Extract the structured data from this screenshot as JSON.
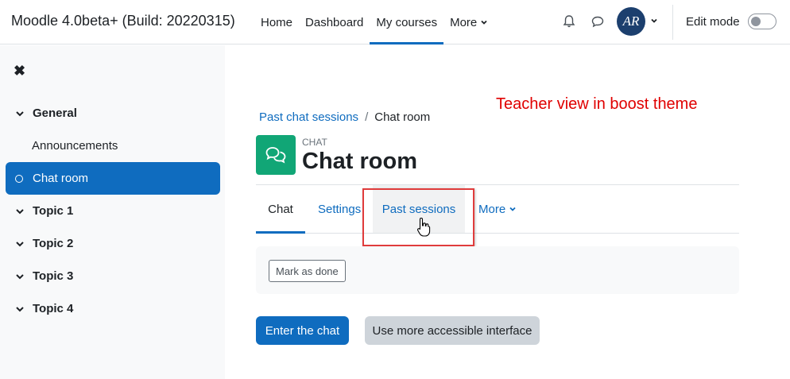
{
  "site": {
    "name": "Moodle 4.0beta+ (Build: 20220315)"
  },
  "primary_nav": [
    {
      "label": "Home"
    },
    {
      "label": "Dashboard"
    },
    {
      "label": "My courses",
      "active": true
    },
    {
      "label": "More",
      "has_caret": true
    }
  ],
  "user": {
    "avatar_initials": "AR"
  },
  "edit_mode": {
    "label": "Edit mode",
    "on": false
  },
  "drawer": {
    "items": [
      {
        "label": "General",
        "type": "section"
      },
      {
        "label": "Announcements",
        "type": "activity"
      },
      {
        "label": "Chat room",
        "type": "activity",
        "active": true
      },
      {
        "label": "Topic 1",
        "type": "section"
      },
      {
        "label": "Topic 2",
        "type": "section"
      },
      {
        "label": "Topic 3",
        "type": "section"
      },
      {
        "label": "Topic 4",
        "type": "section"
      }
    ]
  },
  "annotation": "Teacher view in boost theme",
  "breadcrumb": {
    "link": "Past chat sessions",
    "separator": "/",
    "current": "Chat room"
  },
  "activity": {
    "type_label": "CHAT",
    "title": "Chat room"
  },
  "secondary_nav": {
    "tabs": [
      {
        "label": "Chat",
        "active": true
      },
      {
        "label": "Settings"
      },
      {
        "label": "Past sessions",
        "hovered": true
      },
      {
        "label": "More",
        "has_caret": true
      }
    ]
  },
  "completion": {
    "button_label": "Mark as done"
  },
  "actions": {
    "primary": "Enter the chat",
    "secondary": "Use more accessible interface"
  },
  "colors": {
    "brand": "#0f6cbf",
    "chat_icon_bg": "#11a676",
    "annotation": "#e00000",
    "highlight_border": "#e03c3c"
  }
}
